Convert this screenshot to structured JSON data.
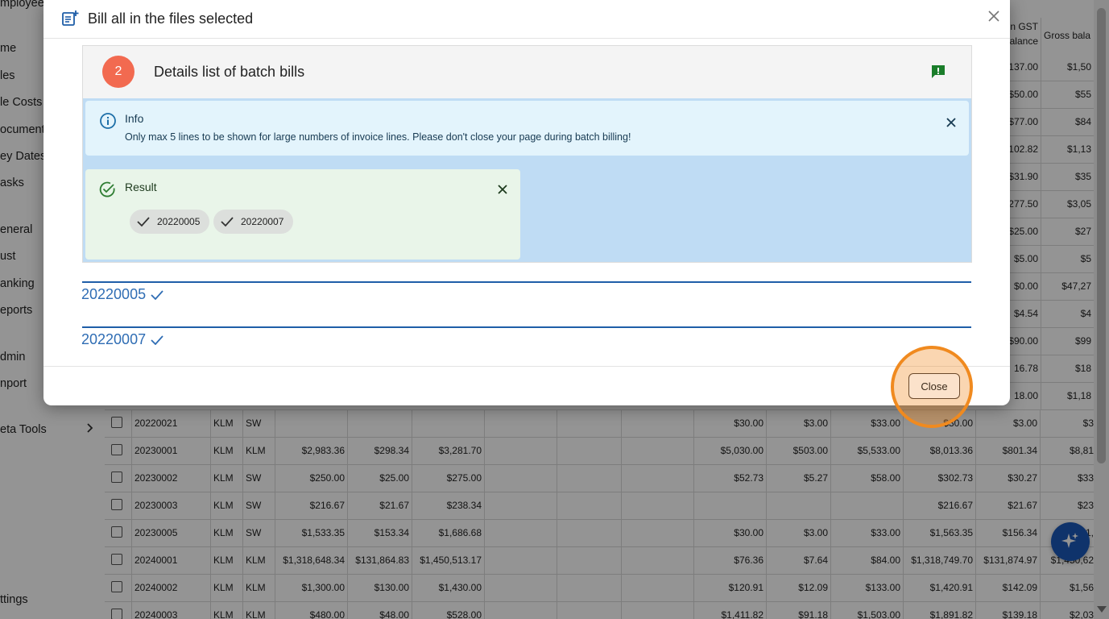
{
  "sidebar": {
    "top_partial": "mployee",
    "items": [
      "me",
      "les",
      "le Costs",
      "ocument",
      "ey Dates",
      "asks",
      "eneral",
      "ust",
      "anking",
      "eports",
      "dmin",
      "nport",
      "eta Tools",
      "ttings"
    ]
  },
  "table": {
    "headers": {
      "partial_gst": "n GST",
      "partial_balance": "alance",
      "gross_balance": "Gross bala"
    },
    "upper_partial_values": [
      [
        "137.00",
        "$1,50"
      ],
      [
        "$50.00",
        "$55"
      ],
      [
        "$77.00",
        "$84"
      ],
      [
        "102.82",
        "$1,13"
      ],
      [
        "$31.90",
        "$35"
      ],
      [
        "277.50",
        "$3,05"
      ],
      [
        "$25.00",
        "$27"
      ],
      [
        "$5.00",
        "$5"
      ],
      [
        "$0.00",
        "$47,27"
      ],
      [
        "$4.54",
        "$4"
      ],
      [
        "$90.00",
        "$99"
      ],
      [
        "16.78",
        "$18"
      ],
      [
        "18.00",
        "$1,18"
      ]
    ],
    "rows": [
      [
        "20220021",
        "KLM",
        "SW",
        "",
        "",
        "",
        "",
        "",
        "",
        "$30.00",
        "$3.00",
        "$33.00",
        "$30.00",
        "$3.00",
        "$3"
      ],
      [
        "20230001",
        "KLM",
        "KLM",
        "$2,983.36",
        "$298.34",
        "$3,281.70",
        "",
        "",
        "",
        "$5,030.00",
        "$503.00",
        "$5,533.00",
        "$8,013.36",
        "$801.34",
        "$8,81"
      ],
      [
        "20230002",
        "KLM",
        "SW",
        "$250.00",
        "$25.00",
        "$275.00",
        "",
        "",
        "",
        "$52.73",
        "$5.27",
        "$58.00",
        "$302.73",
        "$30.27",
        "$33"
      ],
      [
        "20230003",
        "KLM",
        "SW",
        "$216.67",
        "$21.67",
        "$238.34",
        "",
        "",
        "",
        "",
        "",
        "",
        "$216.67",
        "$21.67",
        "$23"
      ],
      [
        "20230005",
        "KLM",
        "SW",
        "$1,533.35",
        "$153.34",
        "$1,686.68",
        "",
        "",
        "",
        "$30.00",
        "$3.00",
        "$33.00",
        "$1,563.35",
        "$156.34",
        "$1,"
      ],
      [
        "20240001",
        "KLM",
        "KLM",
        "$1,318,648.34",
        "$131,864.83",
        "$1,450,513.17",
        "",
        "",
        "",
        "$76.36",
        "$7.64",
        "$84.00",
        "$1,318,749.70",
        "$131,874.97",
        "$1,450,62"
      ],
      [
        "20240002",
        "KLM",
        "KLM",
        "$1,300.00",
        "$130.00",
        "$1,430.00",
        "",
        "",
        "",
        "$120.91",
        "$12.09",
        "$133.00",
        "$1,420.91",
        "$142.09",
        "$1,56"
      ],
      [
        "20240003",
        "KLM",
        "KLM",
        "$480.00",
        "$48.00",
        "$528.00",
        "",
        "",
        "",
        "$1,411.82",
        "$91.18",
        "$1,503.00",
        "$1,891.82",
        "$139.18",
        "$2,03"
      ]
    ]
  },
  "modal": {
    "title": "Bill all in the files selected",
    "step_number": "2",
    "step_title": "Details list of batch bills",
    "info": {
      "title": "Info",
      "text": "Only max 5 lines to be shown for large numbers of invoice lines. Please don't close your page during batch billing!"
    },
    "result": {
      "title": "Result",
      "chips": [
        "20220005",
        "20220007"
      ]
    },
    "files": [
      "20220005",
      "20220007"
    ],
    "close_label": "Close"
  },
  "colors": {
    "accent": "#1f5ea8",
    "badge": "#f26a50",
    "highlight": "#f08a1f",
    "success": "#2e7d32"
  }
}
